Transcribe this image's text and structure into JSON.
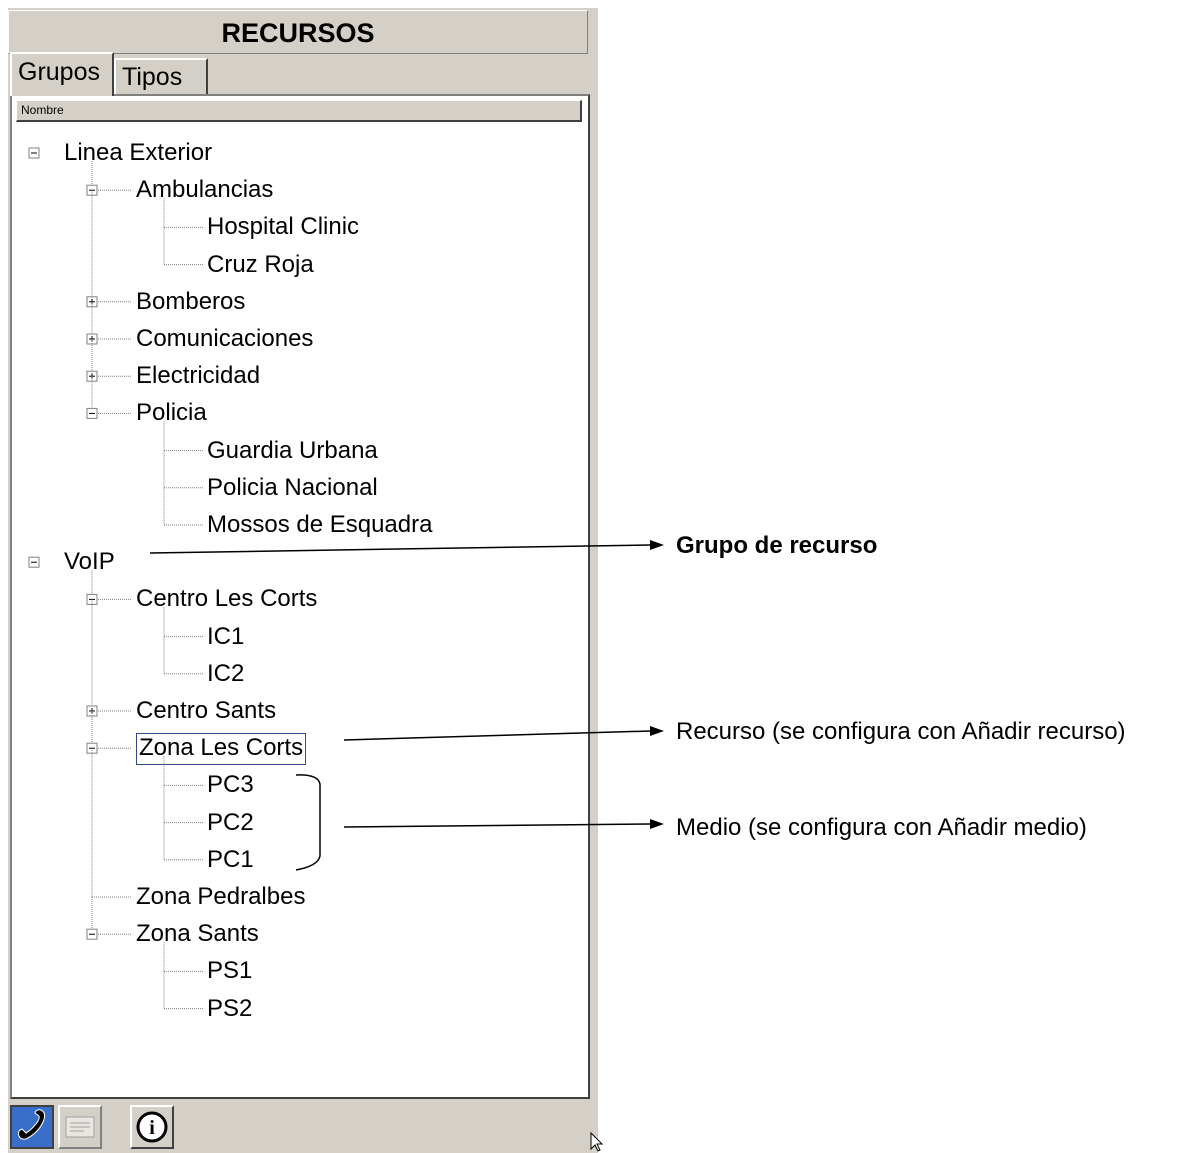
{
  "panel": {
    "title": "RECURSOS",
    "tabs": [
      {
        "label": "Grupos",
        "active": true
      },
      {
        "label": "Tipos",
        "active": false
      }
    ],
    "column_header": "Nombre"
  },
  "tree": [
    {
      "label": "Linea Exterior",
      "level": 0,
      "state": "expanded",
      "is_last": false
    },
    {
      "label": "Ambulancias",
      "level": 1,
      "state": "expanded"
    },
    {
      "label": "Hospital Clinic",
      "level": 2,
      "state": "leaf"
    },
    {
      "label": "Cruz Roja",
      "level": 2,
      "state": "leaf"
    },
    {
      "label": "Bomberos",
      "level": 1,
      "state": "collapsed"
    },
    {
      "label": "Comunicaciones",
      "level": 1,
      "state": "collapsed"
    },
    {
      "label": "Electricidad",
      "level": 1,
      "state": "collapsed"
    },
    {
      "label": "Policia",
      "level": 1,
      "state": "expanded"
    },
    {
      "label": "Guardia Urbana",
      "level": 2,
      "state": "leaf"
    },
    {
      "label": "Policia Nacional",
      "level": 2,
      "state": "leaf"
    },
    {
      "label": "Mossos de Esquadra",
      "level": 2,
      "state": "leaf"
    },
    {
      "label": "VoIP",
      "level": 0,
      "state": "expanded",
      "is_last": true
    },
    {
      "label": "Centro Les Corts",
      "level": 1,
      "state": "expanded"
    },
    {
      "label": "IC1",
      "level": 2,
      "state": "leaf"
    },
    {
      "label": "IC2",
      "level": 2,
      "state": "leaf"
    },
    {
      "label": "Centro Sants",
      "level": 1,
      "state": "collapsed"
    },
    {
      "label": "Zona Les Corts",
      "level": 1,
      "state": "expanded",
      "selected": true
    },
    {
      "label": "PC3",
      "level": 2,
      "state": "leaf"
    },
    {
      "label": "PC2",
      "level": 2,
      "state": "leaf"
    },
    {
      "label": "PC1",
      "level": 2,
      "state": "leaf"
    },
    {
      "label": "Zona Pedralbes",
      "level": 1,
      "state": "leaf"
    },
    {
      "label": "Zona Sants",
      "level": 1,
      "state": "expanded"
    },
    {
      "label": "PS1",
      "level": 2,
      "state": "leaf"
    },
    {
      "label": "PS2",
      "level": 2,
      "state": "leaf"
    }
  ],
  "toolbar": [
    {
      "icon": "phone-icon"
    },
    {
      "icon": "card-icon"
    },
    {
      "icon": "info-icon",
      "glyph": "i"
    }
  ],
  "annotations": {
    "group": "Grupo de recurso",
    "resource": "Recurso (se configura con Añadir recurso)",
    "medium": "Medio (se configura  con Añadir medio)"
  },
  "colors": {
    "panel_bg": "#d4d0c8",
    "tree_bg": "#ffffff",
    "selection_border": "#2c4a8a",
    "phone_button": "#3a6fc9"
  }
}
